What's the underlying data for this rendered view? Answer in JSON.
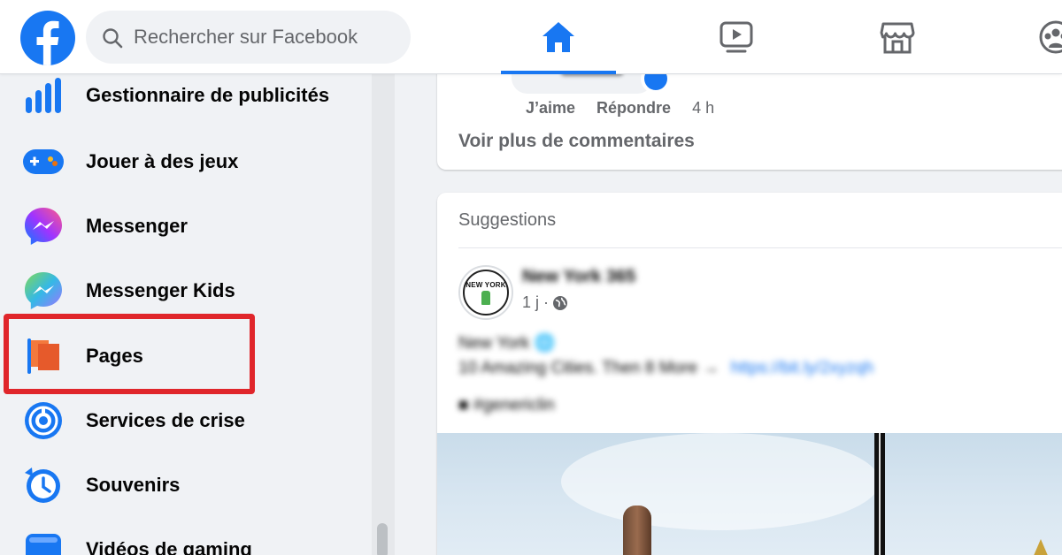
{
  "header": {
    "search_placeholder": "Rechercher sur Facebook",
    "nav_tabs": [
      "home",
      "watch",
      "marketplace",
      "groups"
    ],
    "active_tab": "home",
    "accent_color": "#1877f2"
  },
  "sidebar": {
    "items": [
      {
        "label": "Gestionnaire de publicités",
        "icon": "ads-manager-icon"
      },
      {
        "label": "Jouer à des jeux",
        "icon": "gaming-icon"
      },
      {
        "label": "Messenger",
        "icon": "messenger-icon"
      },
      {
        "label": "Messenger Kids",
        "icon": "messenger-kids-icon"
      },
      {
        "label": "Pages",
        "icon": "pages-flag-icon",
        "highlighted": true
      },
      {
        "label": "Services de crise",
        "icon": "crisis-response-icon"
      },
      {
        "label": "Souvenirs",
        "icon": "memories-clock-icon"
      },
      {
        "label": "Vidéos de gaming",
        "icon": "gaming-video-icon"
      }
    ],
    "highlight_color": "#e0262b"
  },
  "feed": {
    "comment": {
      "like_label": "J’aime",
      "reply_label": "Répondre",
      "time": "4 h",
      "more_comments": "Voir plus de commentaires"
    },
    "suggestions": {
      "title": "Suggestions",
      "page_name": "New York 365",
      "avatar_text": "NEW YORK",
      "post_age": "1 j ·",
      "post_line1": "New York 🌐",
      "post_line2": "10 Amazing Cities. Then 8 More →",
      "post_link": "https://bit.ly/2xyzqh",
      "post_line3": "■ #genericlin"
    }
  }
}
